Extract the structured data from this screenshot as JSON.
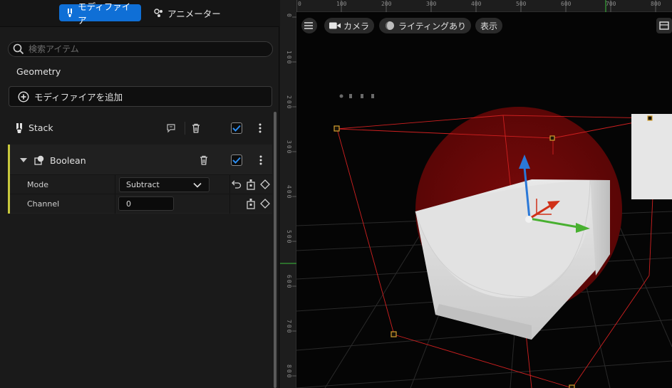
{
  "tabs": {
    "modifier": "モディファイア",
    "animator": "アニメーター"
  },
  "search": {
    "placeholder": "検索アイテム"
  },
  "section_title": "Geometry",
  "add_modifier": "モディファイアを追加",
  "stack": {
    "label": "Stack",
    "checked": true
  },
  "boolean": {
    "label": "Boolean",
    "checked": true,
    "props": {
      "mode_label": "Mode",
      "mode_value": "Subtract",
      "channel_label": "Channel",
      "channel_value": "0"
    }
  },
  "viewport": {
    "camera_label": "カメラ",
    "lighting_label": "ライティングあり",
    "show_label": "表示",
    "ruler_x": [
      "0",
      "100",
      "200",
      "300",
      "400",
      "500",
      "600",
      "700",
      "800"
    ],
    "ruler_y": [
      "0",
      "100",
      "200",
      "300",
      "400",
      "500",
      "600",
      "700",
      "800"
    ]
  },
  "colors": {
    "accent": "#0f6fd6",
    "card_stripe": "#c8c83c",
    "gizmo_x": "#d03018",
    "gizmo_y": "#48b030",
    "gizmo_z": "#2a78d8",
    "bounds": "#d02020",
    "sphere": "#6e0808"
  },
  "icons": [
    "modifier-icon",
    "animator-icon",
    "search-icon",
    "add-circle-icon",
    "stack-icon",
    "comment-icon",
    "trash-icon",
    "check-icon",
    "more-icon",
    "chevron-down-icon",
    "boolean-icon",
    "reset-icon",
    "keyframe-icon",
    "menu-icon",
    "camera-icon",
    "lighting-icon"
  ]
}
